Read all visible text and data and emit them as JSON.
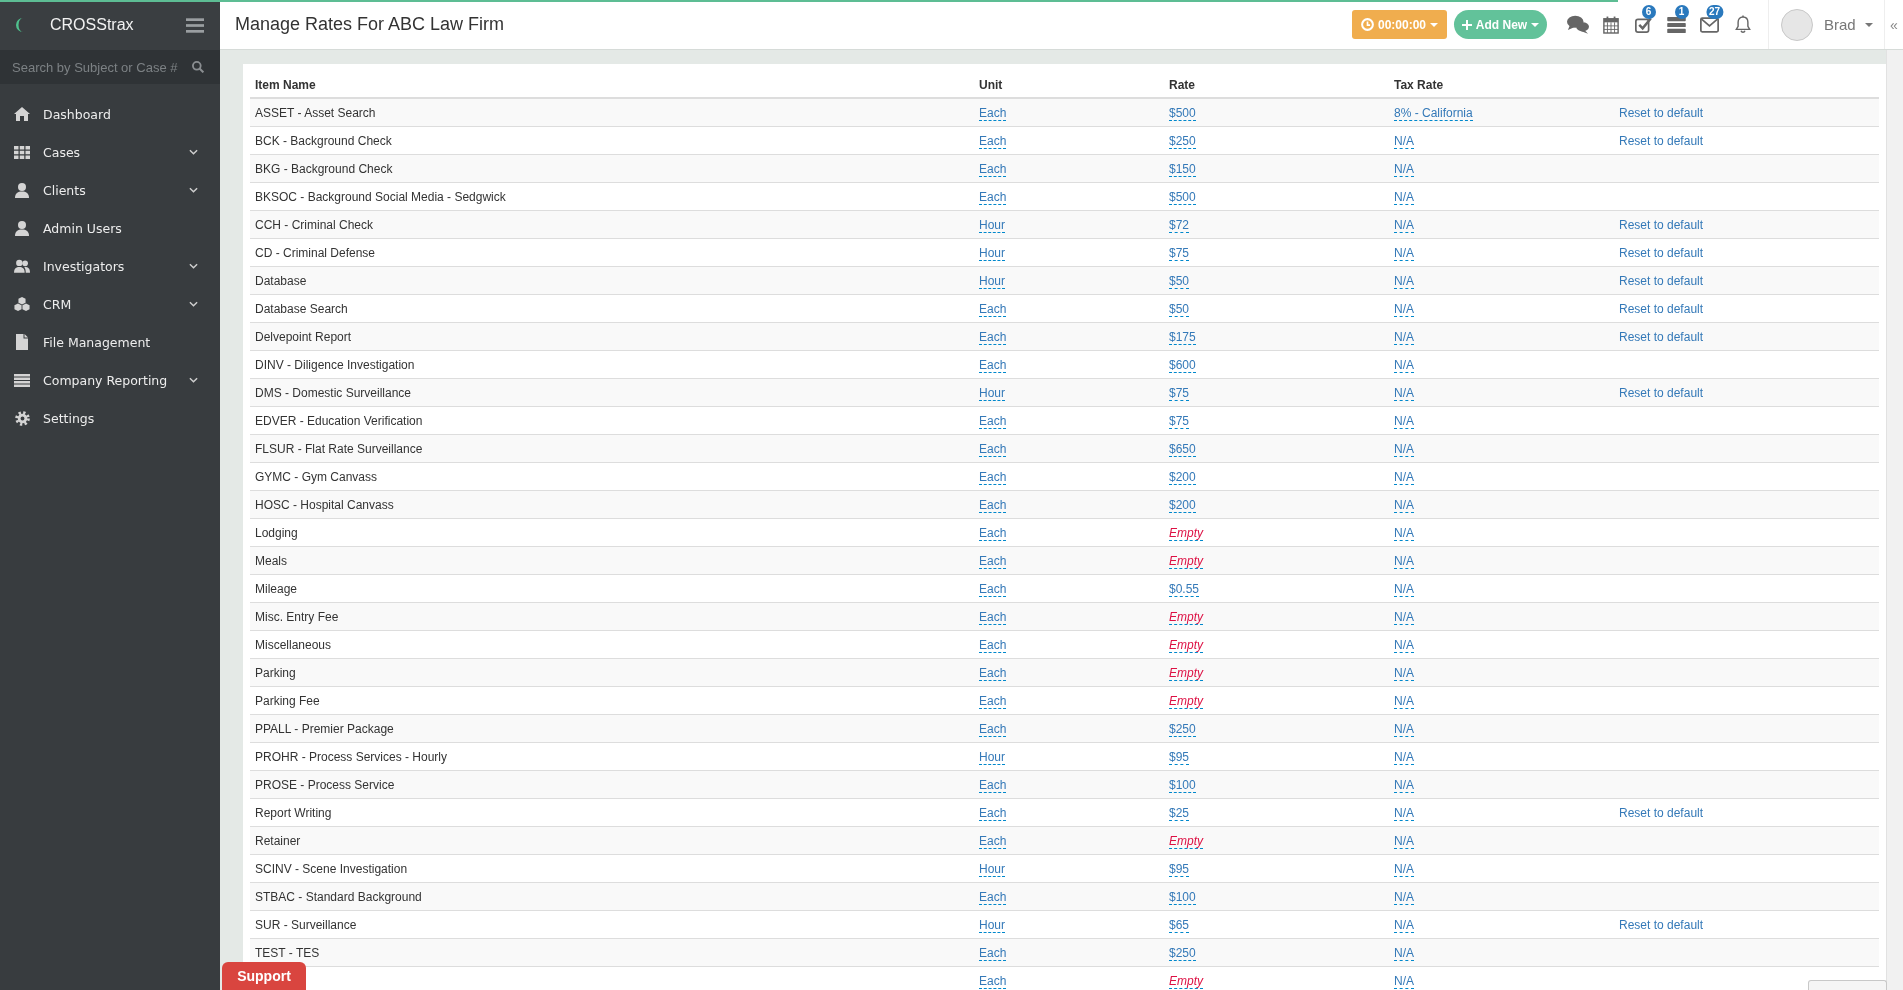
{
  "loading_bar": {
    "level": 0.85
  },
  "sidebar": {
    "brand": "CROSStrax",
    "search": {
      "placeholder": "Search by Subject or Case #"
    },
    "items": [
      {
        "label": "Dashboard",
        "submenu": false
      },
      {
        "label": "Cases",
        "submenu": true
      },
      {
        "label": "Clients",
        "submenu": true
      },
      {
        "label": "Admin Users",
        "submenu": false
      },
      {
        "label": "Investigators",
        "submenu": true
      },
      {
        "label": "CRM",
        "submenu": true
      },
      {
        "label": "File Management",
        "submenu": false
      },
      {
        "label": "Company Reporting",
        "submenu": true
      },
      {
        "label": "Settings",
        "submenu": false
      }
    ]
  },
  "header": {
    "title": "Manage Rates For ABC Law Firm",
    "timer": {
      "label": "00:00:00"
    },
    "add_new": {
      "label": "Add New"
    },
    "toolbar": [
      {
        "kind": "chat"
      },
      {
        "kind": "calendar"
      },
      {
        "kind": "tasks",
        "badge": "6"
      },
      {
        "kind": "list",
        "badge": "1"
      },
      {
        "kind": "mail",
        "badge": "27"
      },
      {
        "kind": "alerts"
      }
    ],
    "user": {
      "name": "Brad"
    },
    "collapse": "«"
  },
  "table": {
    "columns": [
      "Item Name",
      "Unit",
      "Rate",
      "Tax Rate"
    ],
    "rows": [
      {
        "item": "ASSET - Asset Search",
        "unit": "Each",
        "rate": "$500",
        "rate_empty": false,
        "tax_rate": "8% - California",
        "reset": "Reset to default"
      },
      {
        "item": "BCK - Background Check",
        "unit": "Each",
        "rate": "$250",
        "rate_empty": false,
        "tax_rate": "N/A",
        "reset": "Reset to default"
      },
      {
        "item": "BKG - Background Check",
        "unit": "Each",
        "rate": "$150",
        "rate_empty": false,
        "tax_rate": "N/A"
      },
      {
        "item": "BKSOC - Background Social Media - Sedgwick",
        "unit": "Each",
        "rate": "$500",
        "rate_empty": false,
        "tax_rate": "N/A"
      },
      {
        "item": "CCH - Criminal Check",
        "unit": "Hour",
        "rate": "$72",
        "rate_empty": false,
        "tax_rate": "N/A",
        "reset": "Reset to default"
      },
      {
        "item": "CD - Criminal Defense",
        "unit": "Hour",
        "rate": "$75",
        "rate_empty": false,
        "tax_rate": "N/A",
        "reset": "Reset to default"
      },
      {
        "item": "Database",
        "unit": "Hour",
        "rate": "$50",
        "rate_empty": false,
        "tax_rate": "N/A",
        "reset": "Reset to default"
      },
      {
        "item": "Database Search",
        "unit": "Each",
        "rate": "$50",
        "rate_empty": false,
        "tax_rate": "N/A",
        "reset": "Reset to default"
      },
      {
        "item": "Delvepoint Report",
        "unit": "Each",
        "rate": "$175",
        "rate_empty": false,
        "tax_rate": "N/A",
        "reset": "Reset to default"
      },
      {
        "item": "DINV - Diligence Investigation",
        "unit": "Each",
        "rate": "$600",
        "rate_empty": false,
        "tax_rate": "N/A"
      },
      {
        "item": "DMS - Domestic Surveillance",
        "unit": "Hour",
        "rate": "$75",
        "rate_empty": false,
        "tax_rate": "N/A",
        "reset": "Reset to default"
      },
      {
        "item": "EDVER - Education Verification",
        "unit": "Each",
        "rate": "$75",
        "rate_empty": false,
        "tax_rate": "N/A"
      },
      {
        "item": "FLSUR - Flat Rate Surveillance",
        "unit": "Each",
        "rate": "$650",
        "rate_empty": false,
        "tax_rate": "N/A"
      },
      {
        "item": "GYMC - Gym Canvass",
        "unit": "Each",
        "rate": "$200",
        "rate_empty": false,
        "tax_rate": "N/A"
      },
      {
        "item": "HOSC - Hospital Canvass",
        "unit": "Each",
        "rate": "$200",
        "rate_empty": false,
        "tax_rate": "N/A"
      },
      {
        "item": "Lodging",
        "unit": "Each",
        "rate": "Empty",
        "rate_empty": true,
        "tax_rate": "N/A"
      },
      {
        "item": "Meals",
        "unit": "Each",
        "rate": "Empty",
        "rate_empty": true,
        "tax_rate": "N/A"
      },
      {
        "item": "Mileage",
        "unit": "Each",
        "rate": "$0.55",
        "rate_empty": false,
        "tax_rate": "N/A"
      },
      {
        "item": "Misc. Entry Fee",
        "unit": "Each",
        "rate": "Empty",
        "rate_empty": true,
        "tax_rate": "N/A"
      },
      {
        "item": "Miscellaneous",
        "unit": "Each",
        "rate": "Empty",
        "rate_empty": true,
        "tax_rate": "N/A"
      },
      {
        "item": "Parking",
        "unit": "Each",
        "rate": "Empty",
        "rate_empty": true,
        "tax_rate": "N/A"
      },
      {
        "item": "Parking Fee",
        "unit": "Each",
        "rate": "Empty",
        "rate_empty": true,
        "tax_rate": "N/A"
      },
      {
        "item": "PPALL - Premier Package",
        "unit": "Each",
        "rate": "$250",
        "rate_empty": false,
        "tax_rate": "N/A"
      },
      {
        "item": "PROHR - Process Services - Hourly",
        "unit": "Hour",
        "rate": "$95",
        "rate_empty": false,
        "tax_rate": "N/A"
      },
      {
        "item": "PROSE - Process Service",
        "unit": "Each",
        "rate": "$100",
        "rate_empty": false,
        "tax_rate": "N/A"
      },
      {
        "item": "Report Writing",
        "unit": "Each",
        "rate": "$25",
        "rate_empty": false,
        "tax_rate": "N/A",
        "reset": "Reset to default"
      },
      {
        "item": "Retainer",
        "unit": "Each",
        "rate": "Empty",
        "rate_empty": true,
        "tax_rate": "N/A"
      },
      {
        "item": "SCINV - Scene Investigation",
        "unit": "Hour",
        "rate": "$95",
        "rate_empty": false,
        "tax_rate": "N/A"
      },
      {
        "item": "STBAC - Standard Background",
        "unit": "Each",
        "rate": "$100",
        "rate_empty": false,
        "tax_rate": "N/A"
      },
      {
        "item": "SUR - Surveillance",
        "unit": "Hour",
        "rate": "$65",
        "rate_empty": false,
        "tax_rate": "N/A",
        "reset": "Reset to default"
      },
      {
        "item": "TEST - TES",
        "unit": "Each",
        "rate": "$250",
        "rate_empty": false,
        "tax_rate": "N/A"
      },
      {
        "unit": "Each",
        "rate": "Empty",
        "rate_empty": true,
        "tax_rate": "N/A"
      }
    ]
  },
  "support_button": {
    "label": "Support"
  }
}
